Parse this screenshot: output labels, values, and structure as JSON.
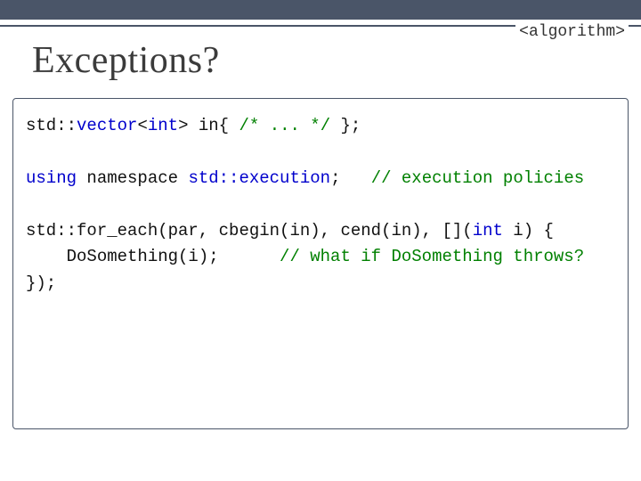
{
  "header": {
    "tag": "<algorithm>",
    "title": "Exceptions?"
  },
  "code": {
    "l1_a": "std::",
    "l1_b": "vector",
    "l1_c": "<",
    "l1_d": "int",
    "l1_e": "> in{ ",
    "l1_f": "/* ... */",
    "l1_g": " };",
    "l2_a": "using",
    "l2_b": " namespace ",
    "l2_c": "std::execution",
    "l2_d": ";   ",
    "l2_e": "// execution policies",
    "l3_a": "std::for_each(par, cbegin(in), cend(in), [](",
    "l3_b": "int",
    "l3_c": " i) {",
    "l4_a": "    DoSomething(i);      ",
    "l4_b": "// what if DoSomething throws?",
    "l5": "});"
  }
}
